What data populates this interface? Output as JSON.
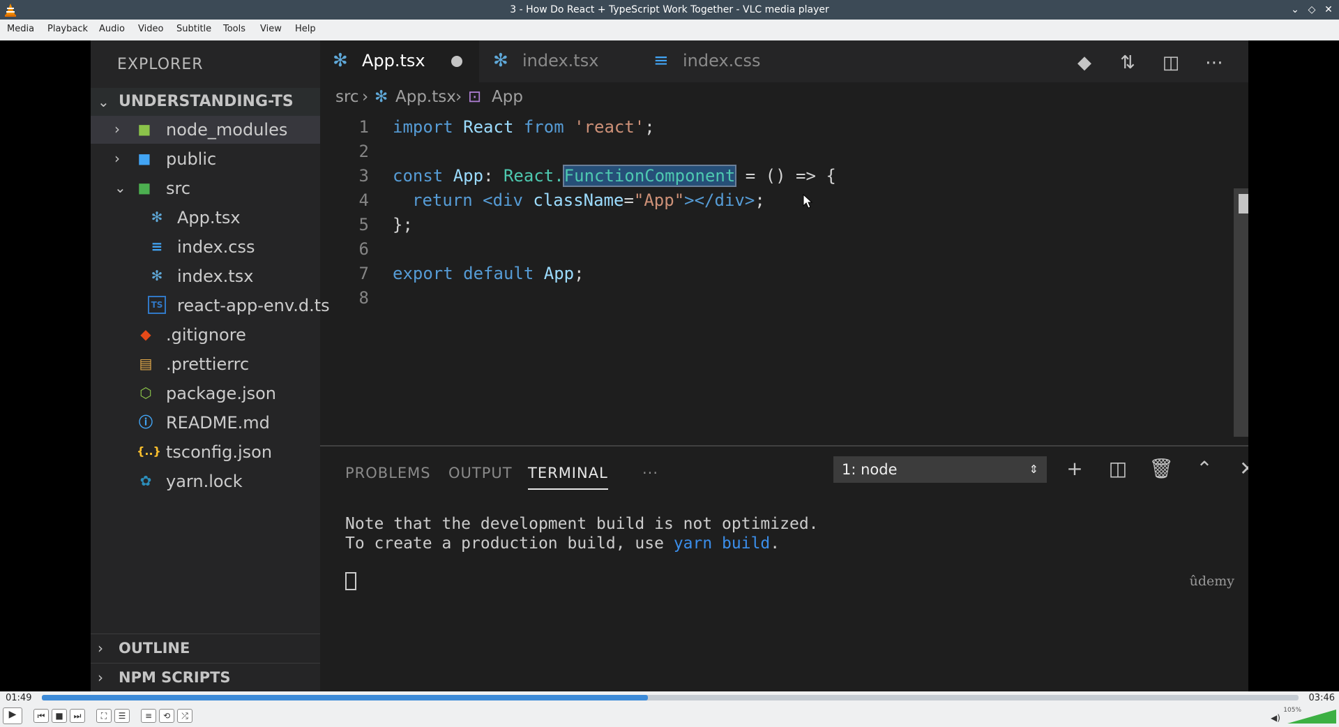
{
  "window": {
    "title": "3 - How Do React + TypeScript Work Together - VLC media player"
  },
  "menu": {
    "items": [
      "Media",
      "Playback",
      "Audio",
      "Video",
      "Subtitle",
      "Tools",
      "View",
      "Help"
    ]
  },
  "vscode": {
    "explorer_title": "EXPLORER",
    "project": "UNDERSTANDING-TS",
    "tree": [
      {
        "label": "node_modules",
        "icon": "folder-node-icon",
        "type": "folder-collapsed"
      },
      {
        "label": "public",
        "icon": "folder-public-icon",
        "type": "folder-collapsed"
      },
      {
        "label": "src",
        "icon": "folder-src-icon",
        "type": "folder-expanded"
      },
      {
        "label": "App.tsx",
        "icon": "react-icon",
        "type": "file"
      },
      {
        "label": "index.css",
        "icon": "css-icon",
        "type": "file"
      },
      {
        "label": "index.tsx",
        "icon": "react-icon",
        "type": "file"
      },
      {
        "label": "react-app-env.d.ts",
        "icon": "typescript-icon",
        "type": "file"
      },
      {
        "label": ".gitignore",
        "icon": "git-icon",
        "type": "file"
      },
      {
        "label": ".prettierrc",
        "icon": "prettier-icon",
        "type": "file"
      },
      {
        "label": "package.json",
        "icon": "nodejs-icon",
        "type": "file"
      },
      {
        "label": "README.md",
        "icon": "info-icon",
        "type": "file"
      },
      {
        "label": "tsconfig.json",
        "icon": "json-icon",
        "type": "file"
      },
      {
        "label": "yarn.lock",
        "icon": "yarn-icon",
        "type": "file"
      }
    ],
    "sections": [
      "OUTLINE",
      "NPM SCRIPTS"
    ],
    "tabs": [
      {
        "label": "App.tsx",
        "icon": "react-icon",
        "active": true,
        "modified": true
      },
      {
        "label": "index.tsx",
        "icon": "react-icon",
        "active": false,
        "modified": false
      },
      {
        "label": "index.css",
        "icon": "css-icon",
        "active": false,
        "modified": false
      }
    ],
    "breadcrumb": [
      "src",
      "App.tsx",
      "App"
    ],
    "line_numbers": [
      "1",
      "2",
      "3",
      "4",
      "5",
      "6",
      "7",
      "8"
    ],
    "code": {
      "l1": {
        "kw": "import",
        "name": "React",
        "from": "from",
        "str": "'react'",
        "end": ";"
      },
      "l3": {
        "kw": "const",
        "name": "App",
        "colon": ":",
        "ns": "React.",
        "type": "FunctionComponent",
        "rest": "= () => {"
      },
      "l4": {
        "kw": "return",
        "open": "<div",
        "attr": "className",
        "eq": "=",
        "val": "\"App\"",
        "close": "></div>",
        "end": ";"
      },
      "l5": "};",
      "l7": {
        "kw1": "export",
        "kw2": "default",
        "name": "App",
        "end": ";"
      }
    },
    "panel": {
      "tabs": [
        "PROBLEMS",
        "OUTPUT",
        "TERMINAL"
      ],
      "active_tab": "TERMINAL",
      "more": "···",
      "terminal_select": "1: node",
      "terminal_lines": {
        "l1": "Note that the development build is not optimized.",
        "l2_prefix": "To create a production build, use ",
        "l2_cmd": "yarn build",
        "l2_suffix": "."
      }
    },
    "watermark": "ûdemy"
  },
  "player": {
    "time_elapsed": "01:49",
    "time_total": "03:46",
    "progress": 0.482,
    "volume": "105%",
    "accent": "#3d8bd8"
  }
}
